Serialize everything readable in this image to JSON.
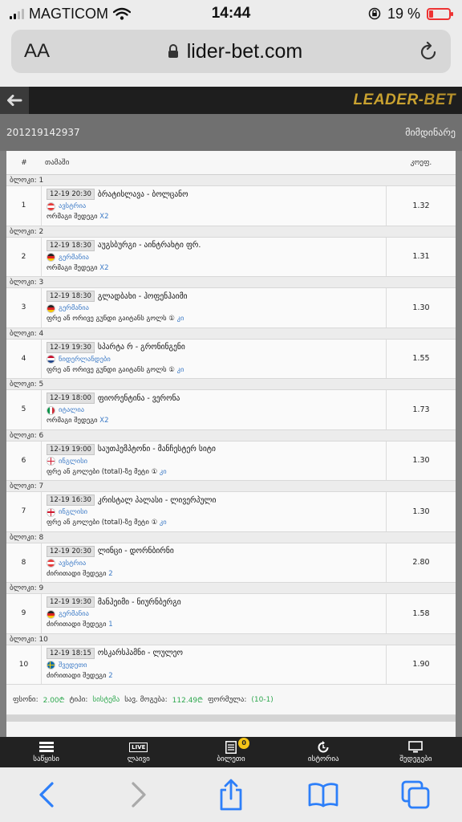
{
  "status": {
    "carrier": "MAGTICOM",
    "time": "14:44",
    "battery": "19 %"
  },
  "browser": {
    "text_size_label": "AA",
    "url": "lider-bet.com"
  },
  "site": {
    "logo_leader": "LEADER",
    "logo_dash": "-",
    "logo_bet": "BET"
  },
  "ticket": {
    "id": "201219142937",
    "status": "მიმდინარე"
  },
  "table": {
    "col_num": "#",
    "col_game": "თამაში",
    "col_odd": "კოეფ."
  },
  "flag_colors": {
    "austria": [
      "#e53a3a",
      "#ffffff",
      "#e53a3a"
    ],
    "germany": [
      "#222222",
      "#dd2222",
      "#f5c400"
    ],
    "netherlands": [
      "#c8102e",
      "#ffffff",
      "#21468b"
    ],
    "italy": [
      "#009246",
      "#ffffff",
      "#ce2b37"
    ],
    "england": [
      "#ffffff",
      "#cf142b"
    ],
    "sweden": [
      "#006aa7",
      "#fecc00"
    ]
  },
  "rows": [
    {
      "block": "ბლოკი: 1",
      "num": "1",
      "time": "12-19 20:30",
      "teams": "ბრატისლავა - ბოლცანო",
      "country": "ავსტრია",
      "flag": "austria",
      "market": "ორმაგი შედეგი ",
      "pick": "X2",
      "odd": "1.32"
    },
    {
      "block": "ბლოკი: 2",
      "num": "2",
      "time": "12-19 18:30",
      "teams": "აუგსბურგი - აინტრახტი ფრ.",
      "country": "გერმანია",
      "flag": "germany",
      "market": "ორმაგი შედეგი ",
      "pick": "X2",
      "odd": "1.31"
    },
    {
      "block": "ბლოკი: 3",
      "num": "3",
      "time": "12-19 18:30",
      "teams": "გლადბახი - ჰოფენჰაიმი",
      "country": "გერმანია",
      "flag": "germany",
      "market": "ფრე ან ორივე გუნდი გაიტანს გოლს ① ",
      "pick": "კი",
      "odd": "1.30"
    },
    {
      "block": "ბლოკი: 4",
      "num": "4",
      "time": "12-19 19:30",
      "teams": "სპარტა რ - გრონინგენი",
      "country": "ნიდერლანდები",
      "flag": "netherlands",
      "market": "ფრე ან ორივე გუნდი გაიტანს გოლს ① ",
      "pick": "კი",
      "odd": "1.55"
    },
    {
      "block": "ბლოკი: 5",
      "num": "5",
      "time": "12-19 18:00",
      "teams": "ფიორენტინა - ვერონა",
      "country": "იტალია",
      "flag": "italy",
      "market": "ორმაგი შედეგი ",
      "pick": "X2",
      "odd": "1.73"
    },
    {
      "block": "ბლოკი: 6",
      "num": "6",
      "time": "12-19 19:00",
      "teams": "საუთჰემპტონი - მანჩესტერ სიტი",
      "country": "ინგლისი",
      "flag": "england",
      "market": "ფრე ან გოლები (total)-ზე მეტი ① ",
      "pick": "კი",
      "odd": "1.30"
    },
    {
      "block": "ბლოკი: 7",
      "num": "7",
      "time": "12-19 16:30",
      "teams": "კრისტალ პალასი - ლივერპული",
      "country": "ინგლისი",
      "flag": "england",
      "market": "ფრე ან გოლები (total)-ზე მეტი ① ",
      "pick": "კი",
      "odd": "1.30"
    },
    {
      "block": "ბლოკი: 8",
      "num": "8",
      "time": "12-19 20:30",
      "teams": "ლინცი - დორნბირნი",
      "country": "ავსტრია",
      "flag": "austria",
      "market": "ძირითადი შედეგი ",
      "pick": "2",
      "odd": "2.80"
    },
    {
      "block": "ბლოკი: 9",
      "num": "9",
      "time": "12-19 19:30",
      "teams": "მანჰეიმი - ნიურნბერგი",
      "country": "გერმანია",
      "flag": "germany",
      "market": "ძირითადი შედეგი ",
      "pick": "1",
      "odd": "1.58"
    },
    {
      "block": "ბლოკი: 10",
      "num": "10",
      "time": "12-19 18:15",
      "teams": "ოსკარსჰამნი - ლულეო",
      "country": "შვედეთი",
      "flag": "sweden",
      "market": "ძირითადი შედეგი ",
      "pick": "2",
      "odd": "1.90"
    }
  ],
  "summary": {
    "stake_label": "ფსონი:",
    "stake_value": "2.00₾",
    "type_label": "ტიპი:",
    "type_value": "სისტემა",
    "win_label": "სავ. მოგება:",
    "win_value": "112.49₾",
    "formula_label": "ფორმულა:",
    "formula_value": "(10-1)"
  },
  "nav": [
    {
      "name": "nav-home",
      "icon": "home-icon",
      "label": "საწყისი"
    },
    {
      "name": "nav-live",
      "icon": "live-icon",
      "label": "ლაივი",
      "icon_text": "LIVE"
    },
    {
      "name": "nav-tickets",
      "icon": "ticket-icon",
      "label": "ბილეთი",
      "badge": "0"
    },
    {
      "name": "nav-history",
      "icon": "history-icon",
      "label": "ისტორია"
    },
    {
      "name": "nav-results",
      "icon": "monitor-icon",
      "label": "შედეგები"
    }
  ],
  "colors": {
    "accent_blue": "#3d7bc7",
    "accent_green": "#2fa84f",
    "logo_gold": "#c9a230",
    "safari_blue": "#2d7ff9"
  }
}
